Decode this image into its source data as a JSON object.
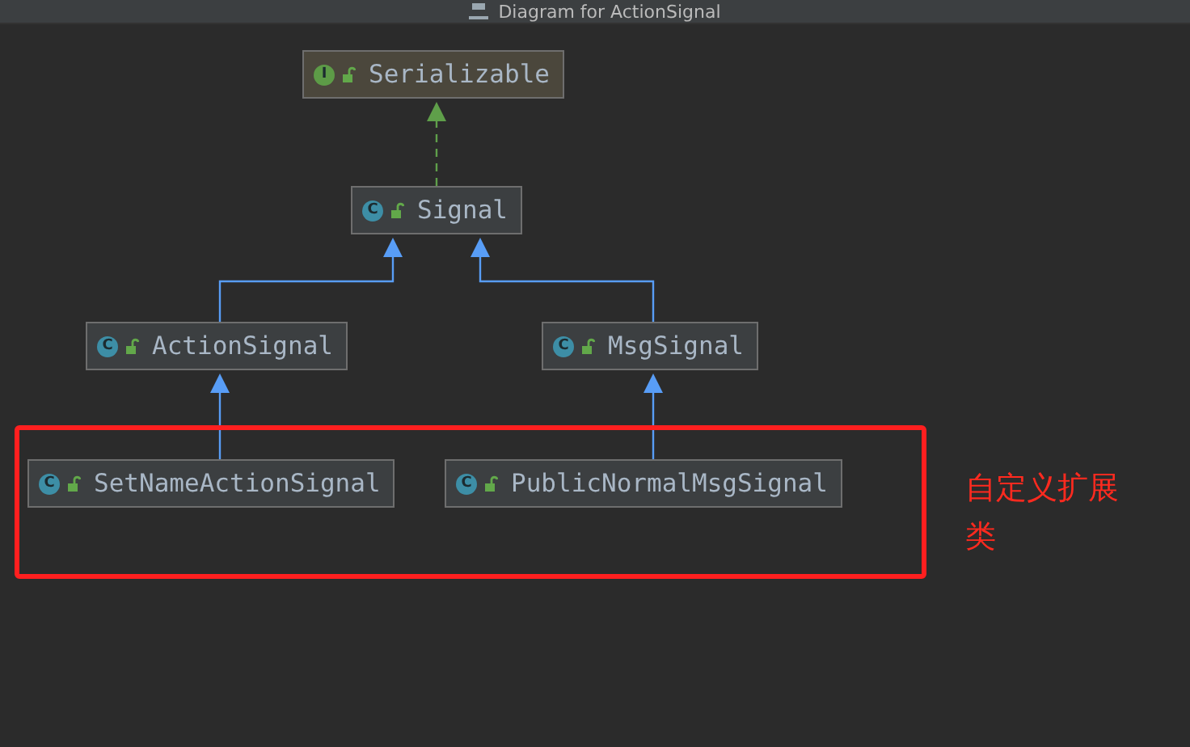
{
  "window": {
    "title": "Diagram for ActionSignal"
  },
  "nodes": [
    {
      "kind": "interface",
      "badge": "I",
      "name": "Serializable"
    },
    {
      "kind": "class",
      "badge": "C",
      "name": "Signal"
    },
    {
      "kind": "class",
      "badge": "C",
      "name": "ActionSignal"
    },
    {
      "kind": "class",
      "badge": "C",
      "name": "MsgSignal"
    },
    {
      "kind": "class",
      "badge": "C",
      "name": "SetNameActionSignal"
    },
    {
      "kind": "class",
      "badge": "C",
      "name": "PublicNormalMsgSignal"
    }
  ],
  "relations": [
    {
      "kind": "implements"
    },
    {
      "kind": "extends"
    },
    {
      "kind": "extends"
    },
    {
      "kind": "extends"
    },
    {
      "kind": "extends"
    }
  ],
  "annotation": {
    "text": "自定义扩展类"
  }
}
